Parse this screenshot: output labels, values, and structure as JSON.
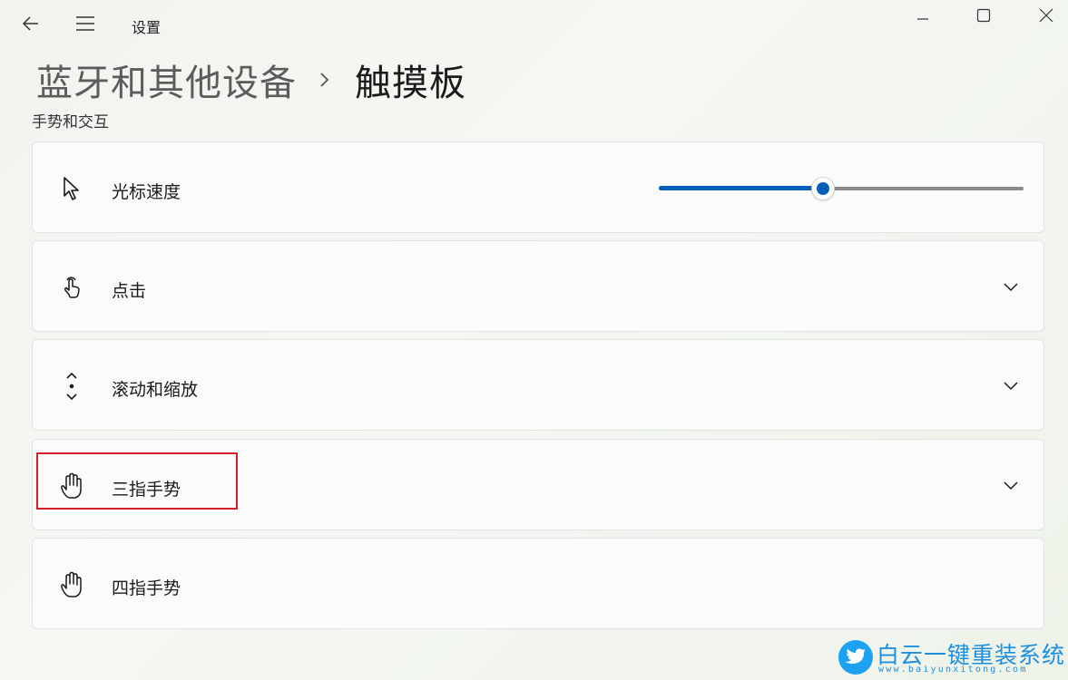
{
  "window": {
    "app_title": "设置",
    "back_icon": "arrow-left-icon",
    "menu_icon": "hamburger-menu-icon",
    "min_icon": "minimize-icon",
    "max_icon": "maximize-icon",
    "close_icon": "close-icon"
  },
  "breadcrumb": {
    "parent": "蓝牙和其他设备",
    "current": "触摸板"
  },
  "section": {
    "title": "手势和交互"
  },
  "settings": [
    {
      "id": "cursor-speed",
      "label": "光标速度",
      "icon": "cursor-pointer-icon",
      "control": "slider",
      "slider_value": 0.45
    },
    {
      "id": "taps",
      "label": "点击",
      "icon": "tap-finger-icon",
      "control": "expander"
    },
    {
      "id": "scroll-zoom",
      "label": "滚动和缩放",
      "icon": "scroll-arrows-icon",
      "control": "expander"
    },
    {
      "id": "three-finger",
      "label": "三指手势",
      "icon": "hand-icon",
      "control": "expander",
      "highlighted": true
    },
    {
      "id": "four-finger",
      "label": "四指手势",
      "icon": "hand-icon",
      "control": "none"
    }
  ],
  "colors": {
    "accent": "#005fb8",
    "highlight_border": "#d4202a",
    "watermark": "#1d8fe0"
  },
  "watermark": {
    "brand": "白云一键重装系统",
    "url": "www.baiyunxitong.com"
  }
}
